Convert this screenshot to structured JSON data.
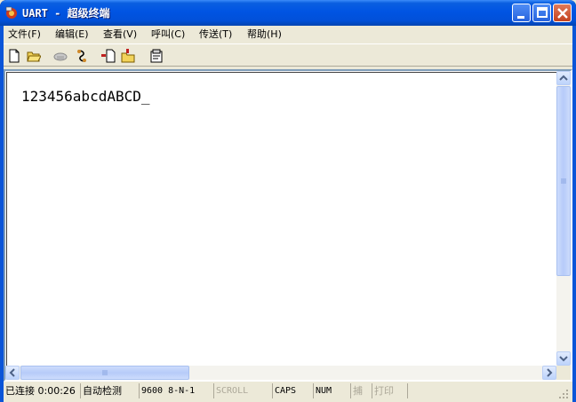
{
  "window": {
    "title": "UART - 超级终端"
  },
  "menu": [
    {
      "label": "文件",
      "accel": "(F)"
    },
    {
      "label": "编辑",
      "accel": "(E)"
    },
    {
      "label": "查看",
      "accel": "(V)"
    },
    {
      "label": "呼叫",
      "accel": "(C)"
    },
    {
      "label": "传送",
      "accel": "(T)"
    },
    {
      "label": "帮助",
      "accel": "(H)"
    }
  ],
  "toolbar": {
    "icons": [
      "new-icon",
      "open-icon",
      "phone-icon",
      "disconnect-icon",
      "send-icon",
      "receive-icon",
      "properties-icon"
    ]
  },
  "terminal": {
    "text": "123456abcdABCD_"
  },
  "status": {
    "connection": "已连接 0:00:26",
    "detect": "自动检测",
    "params": "9600 8-N-1",
    "scroll": "SCROLL",
    "caps": "CAPS",
    "num": "NUM",
    "capture": "捕",
    "print": "打印"
  },
  "colors": {
    "title_bar": "#0054e3",
    "face": "#ece9d8",
    "close_button": "#c4421e"
  }
}
